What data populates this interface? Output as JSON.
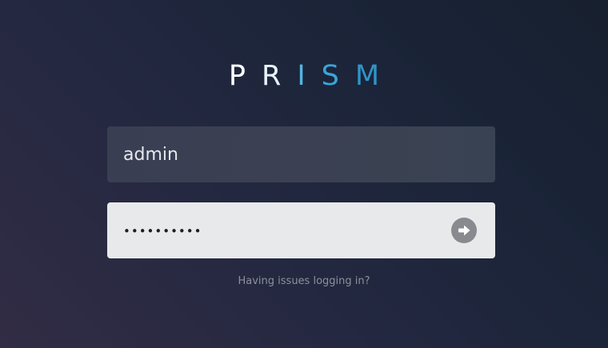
{
  "brand": {
    "letters": [
      {
        "char": "P",
        "color": "#ffffff"
      },
      {
        "char": "R",
        "color": "#e6f4fa"
      },
      {
        "char": "I",
        "color": "#52b5e0"
      },
      {
        "char": "S",
        "color": "#3aa5d8"
      },
      {
        "char": "M",
        "color": "#2f95c8"
      }
    ]
  },
  "login": {
    "username_value": "admin",
    "password_mask": "••••••••••",
    "submit_icon": "arrow-right-icon",
    "help_text": "Having issues logging in?"
  }
}
